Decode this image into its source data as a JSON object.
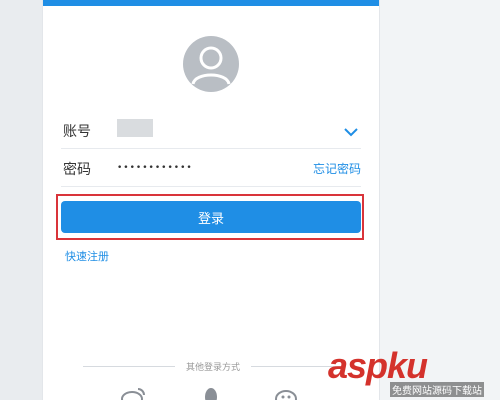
{
  "login": {
    "account_label": "账号",
    "account_value": "",
    "password_label": "密码",
    "password_value": "••••••••••••",
    "forgot_password": "忘记密码",
    "login_button": "登录",
    "quick_register": "快速注册",
    "other_methods": "其他登录方式"
  },
  "social_icons": [
    "weibo-icon",
    "qq-icon",
    "wechat-icon"
  ],
  "watermark": {
    "logo": "aspku",
    "tagline": "免费网站源码下载站"
  },
  "colors": {
    "accent": "#1f8ee5",
    "highlight": "#d9343a",
    "watermark": "#d4322c"
  }
}
